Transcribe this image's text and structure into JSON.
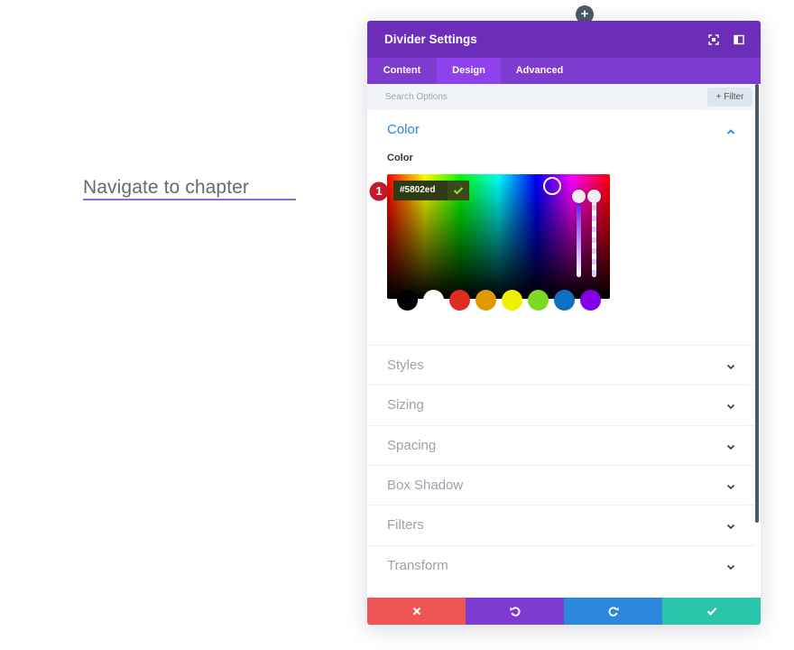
{
  "page": {
    "link_text": "Navigate to chapter"
  },
  "add_button": {
    "icon": "plus-icon",
    "glyph": "+"
  },
  "modal": {
    "title": "Divider Settings",
    "header_icons": [
      "fullscreen-icon",
      "sidebar-toggle-icon"
    ],
    "tabs": [
      {
        "label": "Content",
        "active": false
      },
      {
        "label": "Design",
        "active": true
      },
      {
        "label": "Advanced",
        "active": false
      }
    ],
    "search": {
      "placeholder": "Search Options"
    },
    "filter_button": {
      "label": "+ Filter"
    },
    "color_section": {
      "title": "Color",
      "field_label": "Color",
      "hex_value": "#5802ed",
      "badge_number": "1",
      "swatches": [
        "#000000",
        "#ffffff",
        "#e02b20",
        "#e09900",
        "#edf000",
        "#7cda24",
        "#0c71c3",
        "#8300e9"
      ]
    },
    "sections": [
      {
        "label": "Styles"
      },
      {
        "label": "Sizing"
      },
      {
        "label": "Spacing"
      },
      {
        "label": "Box Shadow"
      },
      {
        "label": "Filters"
      },
      {
        "label": "Transform"
      }
    ],
    "footer_buttons": [
      {
        "action": "discard",
        "icon": "close-icon",
        "color": "#ef5555"
      },
      {
        "action": "undo",
        "icon": "undo-icon",
        "color": "#7e3bd0"
      },
      {
        "action": "redo",
        "icon": "redo-icon",
        "color": "#2b87da"
      },
      {
        "action": "save",
        "icon": "check-icon",
        "color": "#29c4a9"
      }
    ]
  },
  "colors": {
    "header": "#6c2eb9",
    "tabs": "#7e3bd0",
    "active_tab": "#8f42ec",
    "section_title_open": "#2b87da",
    "link_underline": "#8e6ad8"
  }
}
